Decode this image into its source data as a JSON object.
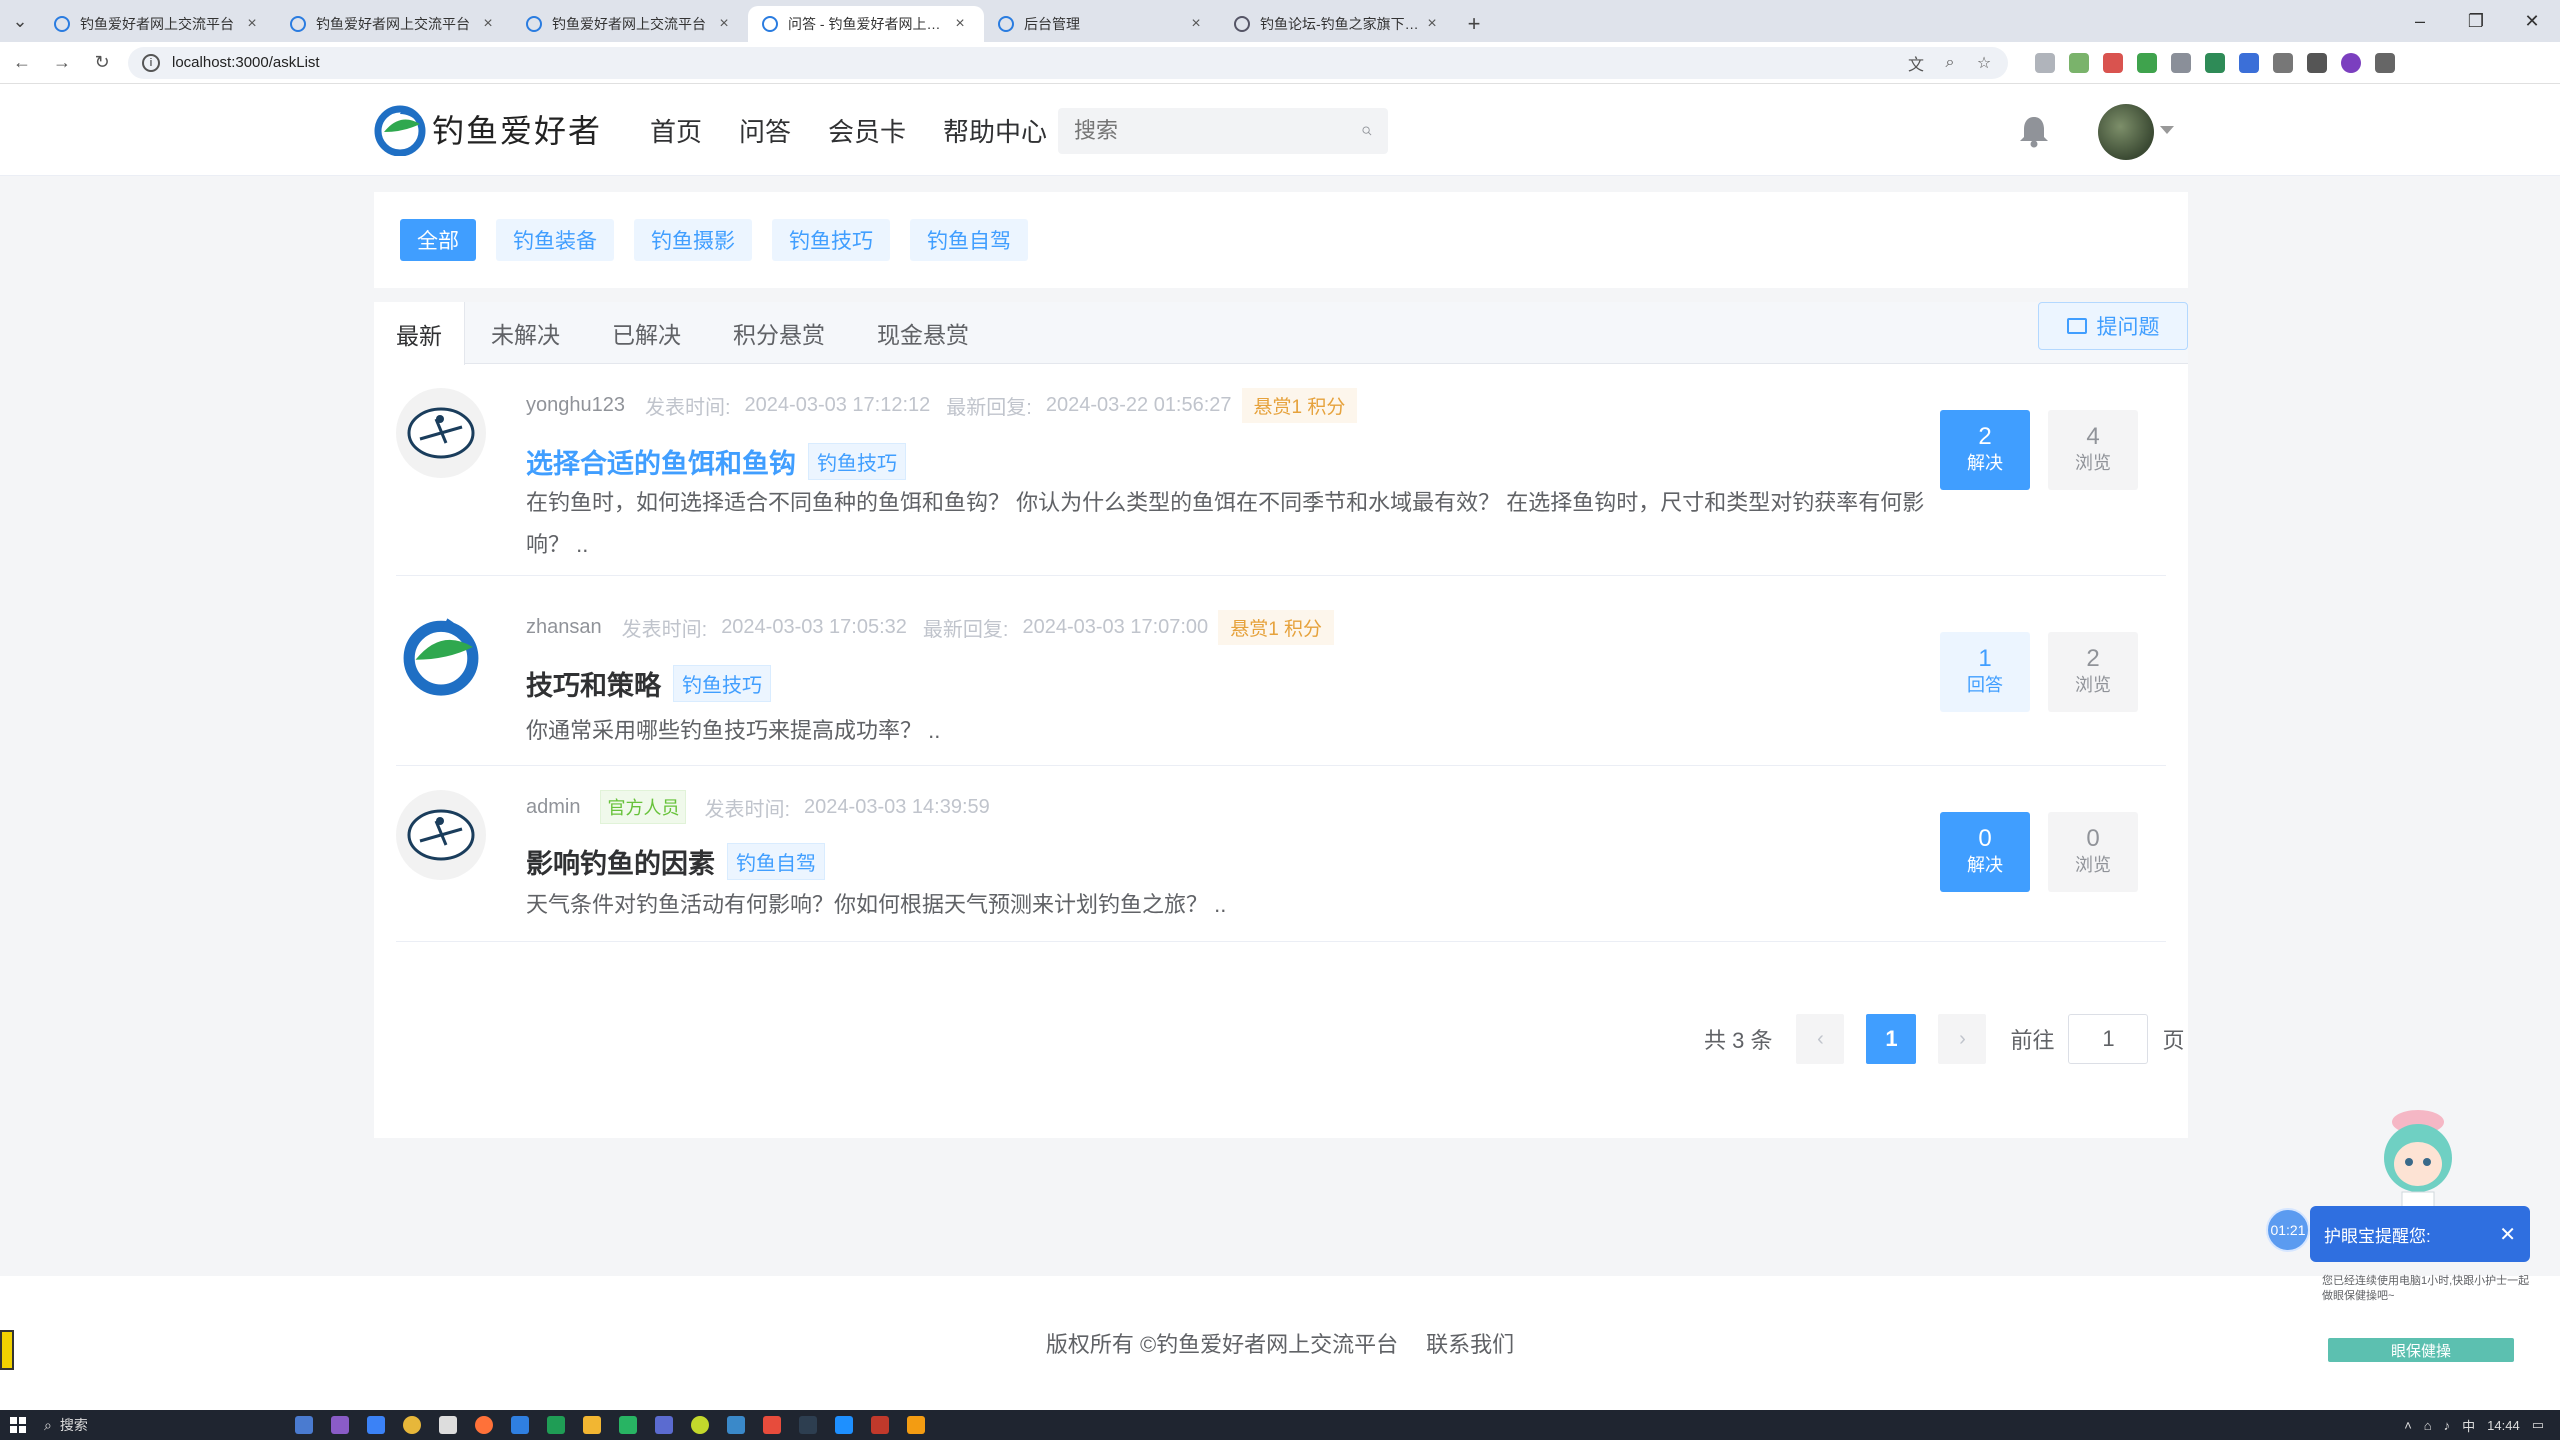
{
  "browser": {
    "tabs": [
      {
        "label": "钓鱼爱好者网上交流平台",
        "active": false
      },
      {
        "label": "钓鱼爱好者网上交流平台",
        "active": false
      },
      {
        "label": "钓鱼爱好者网上交流平台",
        "active": false
      },
      {
        "label": "问答 - 钓鱼爱好者网上交流平台",
        "active": true
      },
      {
        "label": "后台管理",
        "active": false
      },
      {
        "label": "钓鱼论坛-钓鱼之家旗下钓鱼交",
        "active": false
      }
    ],
    "url": "localhost:3000/askList"
  },
  "header": {
    "logo_text": "钓鱼爱好者",
    "nav": [
      "首页",
      "问答",
      "会员卡",
      "帮助中心"
    ],
    "search_placeholder": "搜索"
  },
  "categories": [
    "全部",
    "钓鱼装备",
    "钓鱼摄影",
    "钓鱼技巧",
    "钓鱼自驾"
  ],
  "list_tabs": [
    "最新",
    "未解决",
    "已解决",
    "积分悬赏",
    "现金悬赏"
  ],
  "ask_button": "提问题",
  "questions": [
    {
      "user": "yonghu123",
      "posted_label": "发表时间:",
      "posted": "2024-03-03 17:12:12",
      "reply_label": "最新回复:",
      "reply": "2024-03-22 01:56:27",
      "reward": "悬赏1 积分",
      "title": "选择合适的鱼饵和鱼钩",
      "tag": "钓鱼技巧",
      "desc": "在钓鱼时，如何选择适合不同鱼种的鱼饵和鱼钩？ 你认为什么类型的鱼饵在不同季节和水域最有效？ 在选择鱼钩时，尺寸和类型对钓获率有何影响？ ..",
      "answers": "2",
      "answers_label": "解决",
      "views": "4",
      "views_label": "浏览"
    },
    {
      "user": "zhansan",
      "posted_label": "发表时间:",
      "posted": "2024-03-03 17:05:32",
      "reply_label": "最新回复:",
      "reply": "2024-03-03 17:07:00",
      "reward": "悬赏1 积分",
      "title": "技巧和策略",
      "tag": "钓鱼技巧",
      "desc": "你通常采用哪些钓鱼技巧来提高成功率？ ..",
      "answers": "1",
      "answers_label": "回答",
      "views": "2",
      "views_label": "浏览"
    },
    {
      "user": "admin",
      "official": "官方人员",
      "posted_label": "发表时间:",
      "posted": "2024-03-03 14:39:59",
      "title": "影响钓鱼的因素",
      "tag": "钓鱼自驾",
      "desc": "天气条件对钓鱼活动有何影响？你如何根据天气预测来计划钓鱼之旅？ ..",
      "answers": "0",
      "answers_label": "解决",
      "views": "0",
      "views_label": "浏览"
    }
  ],
  "pagination": {
    "total": "共 3 条",
    "current": "1",
    "goto_label": "前往",
    "goto_value": "1",
    "page_suffix": "页"
  },
  "footer": {
    "copyright": "版权所有 ©钓鱼爱好者网上交流平台",
    "contact": "联系我们"
  },
  "eye_widget": {
    "timer": "01:21",
    "title": "护眼宝提醒您:",
    "message": "您已经连续使用电脑1小时,快跟小护士一起做眼保健操吧~",
    "button": "眼保健操"
  },
  "taskbar": {
    "search": "搜索",
    "time": "14:44",
    "ime": "中"
  },
  "colors": {
    "primary": "#409eff",
    "reward": "#e6a23c",
    "official": "#67c23a"
  }
}
